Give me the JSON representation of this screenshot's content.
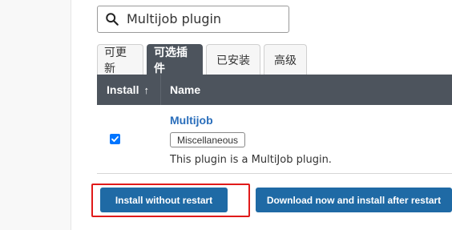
{
  "search": {
    "value": "Multijob plugin",
    "icon": "search-icon"
  },
  "tabs": [
    {
      "label": "可更新",
      "active": false
    },
    {
      "label": "可选插件",
      "active": true
    },
    {
      "label": "已安装",
      "active": false
    },
    {
      "label": "高级",
      "active": false
    }
  ],
  "table": {
    "headers": {
      "install": "Install",
      "sort_indicator": "↑",
      "name": "Name"
    },
    "rows": [
      {
        "checked": true,
        "name": "Multijob",
        "tag": "Miscellaneous",
        "description": "This plugin is a MultiJob plugin."
      }
    ]
  },
  "actions": {
    "install_without_restart": "Install without restart",
    "download_install_after_restart": "Download now and install after restart"
  },
  "colors": {
    "header_bg": "#4d545d",
    "button_bg": "#1f6aa5",
    "link": "#2a6ebb",
    "highlight": "#e01a1a",
    "checkbox": "#0075ff"
  }
}
